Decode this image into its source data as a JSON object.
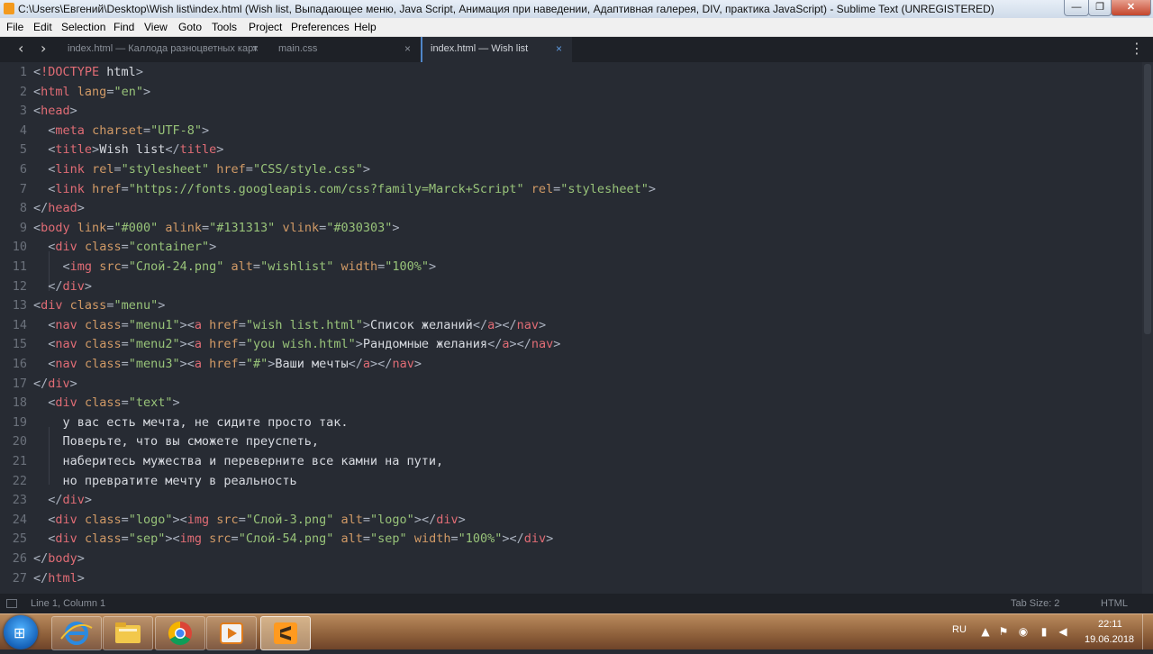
{
  "window": {
    "title": "C:\\Users\\Евгений\\Desktop\\Wish list\\index.html (Wish list, Выпадающее меню, Java Script, Анимация при наведении, Адаптивная галерея, DIV, практика JavaScript) - Sublime Text (UNREGISTERED)",
    "minimize": "—",
    "maximize": "❐",
    "close": "✕"
  },
  "menu": [
    "File",
    "Edit",
    "Selection",
    "Find",
    "View",
    "Goto",
    "Tools",
    "Project",
    "Preferences",
    "Help"
  ],
  "tabs": [
    {
      "label": "index.html — Каллода разноцветных карт",
      "close": "×",
      "active": false
    },
    {
      "label": "main.css",
      "close": "×",
      "active": false
    },
    {
      "label": "index.html — Wish list",
      "close": "×",
      "active": true
    }
  ],
  "nav": {
    "back": "‹",
    "forward": "›",
    "tab_menu": "⋮"
  },
  "code_lines": [
    [
      {
        "c": "p",
        "t": "<"
      },
      {
        "c": "t",
        "t": "!DOCTYPE"
      },
      {
        "c": "x",
        "t": " html"
      },
      {
        "c": "p",
        "t": ">"
      }
    ],
    [
      {
        "c": "p",
        "t": "<"
      },
      {
        "c": "t",
        "t": "html"
      },
      {
        "c": "x",
        "t": " "
      },
      {
        "c": "a",
        "t": "lang"
      },
      {
        "c": "p",
        "t": "="
      },
      {
        "c": "s",
        "t": "\"en\""
      },
      {
        "c": "p",
        "t": ">"
      }
    ],
    [
      {
        "c": "p",
        "t": "<"
      },
      {
        "c": "t",
        "t": "head"
      },
      {
        "c": "p",
        "t": ">"
      }
    ],
    [
      {
        "c": "x",
        "t": "  "
      },
      {
        "c": "p",
        "t": "<"
      },
      {
        "c": "t",
        "t": "meta"
      },
      {
        "c": "x",
        "t": " "
      },
      {
        "c": "a",
        "t": "charset"
      },
      {
        "c": "p",
        "t": "="
      },
      {
        "c": "s",
        "t": "\"UTF-8\""
      },
      {
        "c": "p",
        "t": ">"
      }
    ],
    [
      {
        "c": "x",
        "t": "  "
      },
      {
        "c": "p",
        "t": "<"
      },
      {
        "c": "t",
        "t": "title"
      },
      {
        "c": "p",
        "t": ">"
      },
      {
        "c": "x",
        "t": "Wish list"
      },
      {
        "c": "p",
        "t": "</"
      },
      {
        "c": "t",
        "t": "title"
      },
      {
        "c": "p",
        "t": ">"
      }
    ],
    [
      {
        "c": "x",
        "t": "  "
      },
      {
        "c": "p",
        "t": "<"
      },
      {
        "c": "t",
        "t": "link"
      },
      {
        "c": "x",
        "t": " "
      },
      {
        "c": "a",
        "t": "rel"
      },
      {
        "c": "p",
        "t": "="
      },
      {
        "c": "s",
        "t": "\"stylesheet\""
      },
      {
        "c": "x",
        "t": " "
      },
      {
        "c": "a",
        "t": "href"
      },
      {
        "c": "p",
        "t": "="
      },
      {
        "c": "s",
        "t": "\"CSS/style.css\""
      },
      {
        "c": "p",
        "t": ">"
      }
    ],
    [
      {
        "c": "x",
        "t": "  "
      },
      {
        "c": "p",
        "t": "<"
      },
      {
        "c": "t",
        "t": "link"
      },
      {
        "c": "x",
        "t": " "
      },
      {
        "c": "a",
        "t": "href"
      },
      {
        "c": "p",
        "t": "="
      },
      {
        "c": "s",
        "t": "\"https://fonts.googleapis.com/css?family=Marck+Script\""
      },
      {
        "c": "x",
        "t": " "
      },
      {
        "c": "a",
        "t": "rel"
      },
      {
        "c": "p",
        "t": "="
      },
      {
        "c": "s",
        "t": "\"stylesheet\""
      },
      {
        "c": "p",
        "t": ">"
      }
    ],
    [
      {
        "c": "p",
        "t": "</"
      },
      {
        "c": "t",
        "t": "head"
      },
      {
        "c": "p",
        "t": ">"
      }
    ],
    [
      {
        "c": "p",
        "t": "<"
      },
      {
        "c": "t",
        "t": "body"
      },
      {
        "c": "x",
        "t": " "
      },
      {
        "c": "a",
        "t": "link"
      },
      {
        "c": "p",
        "t": "="
      },
      {
        "c": "s",
        "t": "\"#000\""
      },
      {
        "c": "x",
        "t": " "
      },
      {
        "c": "a",
        "t": "alink"
      },
      {
        "c": "p",
        "t": "="
      },
      {
        "c": "s",
        "t": "\"#131313\""
      },
      {
        "c": "x",
        "t": " "
      },
      {
        "c": "a",
        "t": "vlink"
      },
      {
        "c": "p",
        "t": "="
      },
      {
        "c": "s",
        "t": "\"#030303\""
      },
      {
        "c": "p",
        "t": ">"
      }
    ],
    [
      {
        "c": "x",
        "t": "  "
      },
      {
        "c": "p",
        "t": "<"
      },
      {
        "c": "t",
        "t": "div"
      },
      {
        "c": "x",
        "t": " "
      },
      {
        "c": "a",
        "t": "class"
      },
      {
        "c": "p",
        "t": "="
      },
      {
        "c": "s",
        "t": "\"container\""
      },
      {
        "c": "p",
        "t": ">"
      }
    ],
    [
      {
        "c": "x",
        "t": "    "
      },
      {
        "c": "p",
        "t": "<"
      },
      {
        "c": "t",
        "t": "img"
      },
      {
        "c": "x",
        "t": " "
      },
      {
        "c": "a",
        "t": "src"
      },
      {
        "c": "p",
        "t": "="
      },
      {
        "c": "s",
        "t": "\"Слой-24.png\""
      },
      {
        "c": "x",
        "t": " "
      },
      {
        "c": "a",
        "t": "alt"
      },
      {
        "c": "p",
        "t": "="
      },
      {
        "c": "s",
        "t": "\"wishlist\""
      },
      {
        "c": "x",
        "t": " "
      },
      {
        "c": "a",
        "t": "width"
      },
      {
        "c": "p",
        "t": "="
      },
      {
        "c": "s",
        "t": "\"100%\""
      },
      {
        "c": "p",
        "t": ">"
      }
    ],
    [
      {
        "c": "x",
        "t": "  "
      },
      {
        "c": "p",
        "t": "</"
      },
      {
        "c": "t",
        "t": "div"
      },
      {
        "c": "p",
        "t": ">"
      }
    ],
    [
      {
        "c": "p",
        "t": "<"
      },
      {
        "c": "t",
        "t": "div"
      },
      {
        "c": "x",
        "t": " "
      },
      {
        "c": "a",
        "t": "class"
      },
      {
        "c": "p",
        "t": "="
      },
      {
        "c": "s",
        "t": "\"menu\""
      },
      {
        "c": "p",
        "t": ">"
      }
    ],
    [
      {
        "c": "x",
        "t": "  "
      },
      {
        "c": "p",
        "t": "<"
      },
      {
        "c": "t",
        "t": "nav"
      },
      {
        "c": "x",
        "t": " "
      },
      {
        "c": "a",
        "t": "class"
      },
      {
        "c": "p",
        "t": "="
      },
      {
        "c": "s",
        "t": "\"menu1\""
      },
      {
        "c": "p",
        "t": "><"
      },
      {
        "c": "t",
        "t": "a"
      },
      {
        "c": "x",
        "t": " "
      },
      {
        "c": "a",
        "t": "href"
      },
      {
        "c": "p",
        "t": "="
      },
      {
        "c": "s",
        "t": "\"wish list.html\""
      },
      {
        "c": "p",
        "t": ">"
      },
      {
        "c": "x",
        "t": "Список желаний"
      },
      {
        "c": "p",
        "t": "</"
      },
      {
        "c": "t",
        "t": "a"
      },
      {
        "c": "p",
        "t": "></"
      },
      {
        "c": "t",
        "t": "nav"
      },
      {
        "c": "p",
        "t": ">"
      }
    ],
    [
      {
        "c": "x",
        "t": "  "
      },
      {
        "c": "p",
        "t": "<"
      },
      {
        "c": "t",
        "t": "nav"
      },
      {
        "c": "x",
        "t": " "
      },
      {
        "c": "a",
        "t": "class"
      },
      {
        "c": "p",
        "t": "="
      },
      {
        "c": "s",
        "t": "\"menu2\""
      },
      {
        "c": "p",
        "t": "><"
      },
      {
        "c": "t",
        "t": "a"
      },
      {
        "c": "x",
        "t": " "
      },
      {
        "c": "a",
        "t": "href"
      },
      {
        "c": "p",
        "t": "="
      },
      {
        "c": "s",
        "t": "\"you wish.html\""
      },
      {
        "c": "p",
        "t": ">"
      },
      {
        "c": "x",
        "t": "Рандомные желания"
      },
      {
        "c": "p",
        "t": "</"
      },
      {
        "c": "t",
        "t": "a"
      },
      {
        "c": "p",
        "t": "></"
      },
      {
        "c": "t",
        "t": "nav"
      },
      {
        "c": "p",
        "t": ">"
      }
    ],
    [
      {
        "c": "x",
        "t": "  "
      },
      {
        "c": "p",
        "t": "<"
      },
      {
        "c": "t",
        "t": "nav"
      },
      {
        "c": "x",
        "t": " "
      },
      {
        "c": "a",
        "t": "class"
      },
      {
        "c": "p",
        "t": "="
      },
      {
        "c": "s",
        "t": "\"menu3\""
      },
      {
        "c": "p",
        "t": "><"
      },
      {
        "c": "t",
        "t": "a"
      },
      {
        "c": "x",
        "t": " "
      },
      {
        "c": "a",
        "t": "href"
      },
      {
        "c": "p",
        "t": "="
      },
      {
        "c": "s",
        "t": "\"#\""
      },
      {
        "c": "p",
        "t": ">"
      },
      {
        "c": "x",
        "t": "Ваши мечты"
      },
      {
        "c": "p",
        "t": "</"
      },
      {
        "c": "t",
        "t": "a"
      },
      {
        "c": "p",
        "t": "></"
      },
      {
        "c": "t",
        "t": "nav"
      },
      {
        "c": "p",
        "t": ">"
      }
    ],
    [
      {
        "c": "p",
        "t": "</"
      },
      {
        "c": "t",
        "t": "div"
      },
      {
        "c": "p",
        "t": ">"
      }
    ],
    [
      {
        "c": "x",
        "t": "  "
      },
      {
        "c": "p",
        "t": "<"
      },
      {
        "c": "t",
        "t": "div"
      },
      {
        "c": "x",
        "t": " "
      },
      {
        "c": "a",
        "t": "class"
      },
      {
        "c": "p",
        "t": "="
      },
      {
        "c": "s",
        "t": "\"text\""
      },
      {
        "c": "p",
        "t": ">"
      }
    ],
    [
      {
        "c": "x",
        "t": "    у вас есть мечта, не сидите просто так."
      }
    ],
    [
      {
        "c": "x",
        "t": "    Поверьте, что вы сможете преуспеть,"
      }
    ],
    [
      {
        "c": "x",
        "t": "    наберитесь мужества и переверните все камни на пути,"
      }
    ],
    [
      {
        "c": "x",
        "t": "    но превратите мечту в реальность"
      }
    ],
    [
      {
        "c": "x",
        "t": "  "
      },
      {
        "c": "p",
        "t": "</"
      },
      {
        "c": "t",
        "t": "div"
      },
      {
        "c": "p",
        "t": ">"
      }
    ],
    [
      {
        "c": "x",
        "t": "  "
      },
      {
        "c": "p",
        "t": "<"
      },
      {
        "c": "t",
        "t": "div"
      },
      {
        "c": "x",
        "t": " "
      },
      {
        "c": "a",
        "t": "class"
      },
      {
        "c": "p",
        "t": "="
      },
      {
        "c": "s",
        "t": "\"logo\""
      },
      {
        "c": "p",
        "t": "><"
      },
      {
        "c": "t",
        "t": "img"
      },
      {
        "c": "x",
        "t": " "
      },
      {
        "c": "a",
        "t": "src"
      },
      {
        "c": "p",
        "t": "="
      },
      {
        "c": "s",
        "t": "\"Слой-3.png\""
      },
      {
        "c": "x",
        "t": " "
      },
      {
        "c": "a",
        "t": "alt"
      },
      {
        "c": "p",
        "t": "="
      },
      {
        "c": "s",
        "t": "\"logo\""
      },
      {
        "c": "p",
        "t": "></"
      },
      {
        "c": "t",
        "t": "div"
      },
      {
        "c": "p",
        "t": ">"
      }
    ],
    [
      {
        "c": "x",
        "t": "  "
      },
      {
        "c": "p",
        "t": "<"
      },
      {
        "c": "t",
        "t": "div"
      },
      {
        "c": "x",
        "t": " "
      },
      {
        "c": "a",
        "t": "class"
      },
      {
        "c": "p",
        "t": "="
      },
      {
        "c": "s",
        "t": "\"sep\""
      },
      {
        "c": "p",
        "t": "><"
      },
      {
        "c": "t",
        "t": "img"
      },
      {
        "c": "x",
        "t": " "
      },
      {
        "c": "a",
        "t": "src"
      },
      {
        "c": "p",
        "t": "="
      },
      {
        "c": "s",
        "t": "\"Слой-54.png\""
      },
      {
        "c": "x",
        "t": " "
      },
      {
        "c": "a",
        "t": "alt"
      },
      {
        "c": "p",
        "t": "="
      },
      {
        "c": "s",
        "t": "\"sep\""
      },
      {
        "c": "x",
        "t": " "
      },
      {
        "c": "a",
        "t": "width"
      },
      {
        "c": "p",
        "t": "="
      },
      {
        "c": "s",
        "t": "\"100%\""
      },
      {
        "c": "p",
        "t": "></"
      },
      {
        "c": "t",
        "t": "div"
      },
      {
        "c": "p",
        "t": ">"
      }
    ],
    [
      {
        "c": "p",
        "t": "</"
      },
      {
        "c": "t",
        "t": "body"
      },
      {
        "c": "p",
        "t": ">"
      }
    ],
    [
      {
        "c": "p",
        "t": "</"
      },
      {
        "c": "t",
        "t": "html"
      },
      {
        "c": "p",
        "t": ">"
      }
    ]
  ],
  "statusbar": {
    "position": "Line 1, Column 1",
    "tab_size": "Tab Size: 2",
    "syntax": "HTML"
  },
  "taskbar": {
    "apps": [
      "internet-explorer",
      "file-explorer",
      "chrome",
      "media-player",
      "sublime-text"
    ],
    "language": "RU",
    "time": "22:11",
    "date": "19.06.2018"
  },
  "colors": {
    "editor_bg": "#272b33",
    "tag": "#e06c75",
    "attribute": "#d19a66",
    "string": "#98c379",
    "text": "#d7dae0",
    "line_number": "#6b717b",
    "active_tab_accent": "#4f86c8"
  }
}
